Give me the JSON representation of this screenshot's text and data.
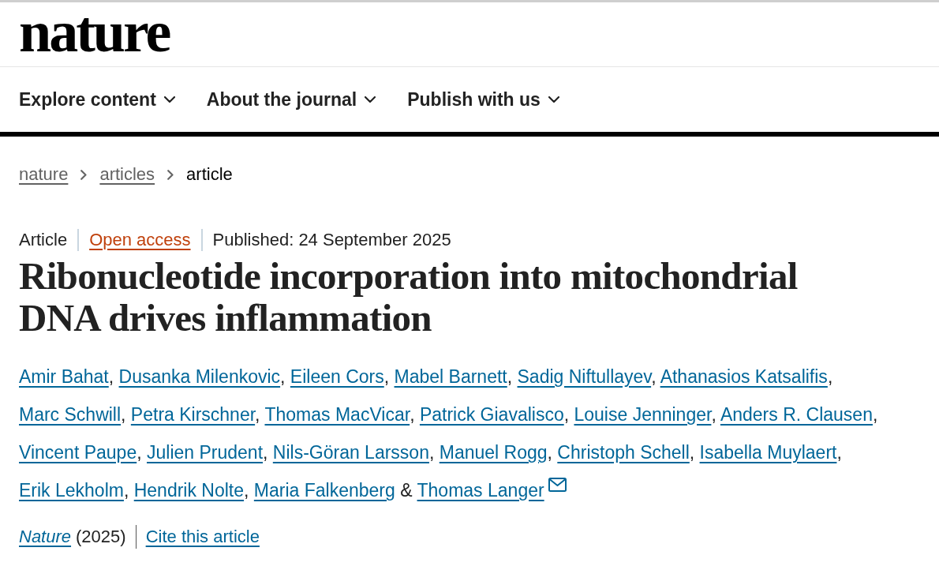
{
  "logo": "nature",
  "nav": [
    {
      "label": "Explore content",
      "expanded": false
    },
    {
      "label": "About the journal",
      "expanded": false
    },
    {
      "label": "Publish with us",
      "expanded": false
    }
  ],
  "breadcrumbs": [
    {
      "label": "nature",
      "current": false
    },
    {
      "label": "articles",
      "current": false
    },
    {
      "label": "article",
      "current": true
    }
  ],
  "meta": [
    {
      "kind": "type",
      "text": "Article"
    },
    {
      "kind": "access",
      "text": "Open access"
    },
    {
      "kind": "date",
      "text": "Published: 24 September 2025"
    }
  ],
  "title": "Ribonucleotide incorporation into mitochondrial DNA drives inflammation",
  "authors": [
    {
      "name": "Amir Bahat",
      "separator": ",",
      "corresponding": false
    },
    {
      "name": "Dusanka Milenkovic",
      "separator": ",",
      "corresponding": false
    },
    {
      "name": "Eileen Cors",
      "separator": ",",
      "corresponding": false
    },
    {
      "name": "Mabel Barnett",
      "separator": ",",
      "corresponding": false
    },
    {
      "name": "Sadig Niftullayev",
      "separator": ",",
      "corresponding": false
    },
    {
      "name": "Athanasios Katsalifis",
      "separator": ",",
      "corresponding": false
    },
    {
      "name": "Marc Schwill",
      "separator": ",",
      "corresponding": false
    },
    {
      "name": "Petra Kirschner",
      "separator": ",",
      "corresponding": false
    },
    {
      "name": "Thomas MacVicar",
      "separator": ",",
      "corresponding": false
    },
    {
      "name": "Patrick Giavalisco",
      "separator": ",",
      "corresponding": false
    },
    {
      "name": "Louise Jenninger",
      "separator": ",",
      "corresponding": false
    },
    {
      "name": "Anders R. Clausen",
      "separator": ",",
      "corresponding": false
    },
    {
      "name": "Vincent Paupe",
      "separator": ",",
      "corresponding": false
    },
    {
      "name": "Julien Prudent",
      "separator": ",",
      "corresponding": false
    },
    {
      "name": "Nils-Göran Larsson",
      "separator": ",",
      "corresponding": false
    },
    {
      "name": "Manuel Rogg",
      "separator": ",",
      "corresponding": false
    },
    {
      "name": "Christoph Schell",
      "separator": ",",
      "corresponding": false
    },
    {
      "name": "Isabella Muylaert",
      "separator": ",",
      "corresponding": false
    },
    {
      "name": "Erik Lekholm",
      "separator": ",",
      "corresponding": false
    },
    {
      "name": "Hendrik Nolte",
      "separator": ",",
      "corresponding": false
    },
    {
      "name": "Maria Falkenberg",
      "joiner": "&",
      "corresponding": false
    },
    {
      "name": "Thomas Langer",
      "corresponding": true
    }
  ],
  "citation": {
    "journal": "Nature",
    "year": "(2025)",
    "cite_link": "Cite this article"
  }
}
